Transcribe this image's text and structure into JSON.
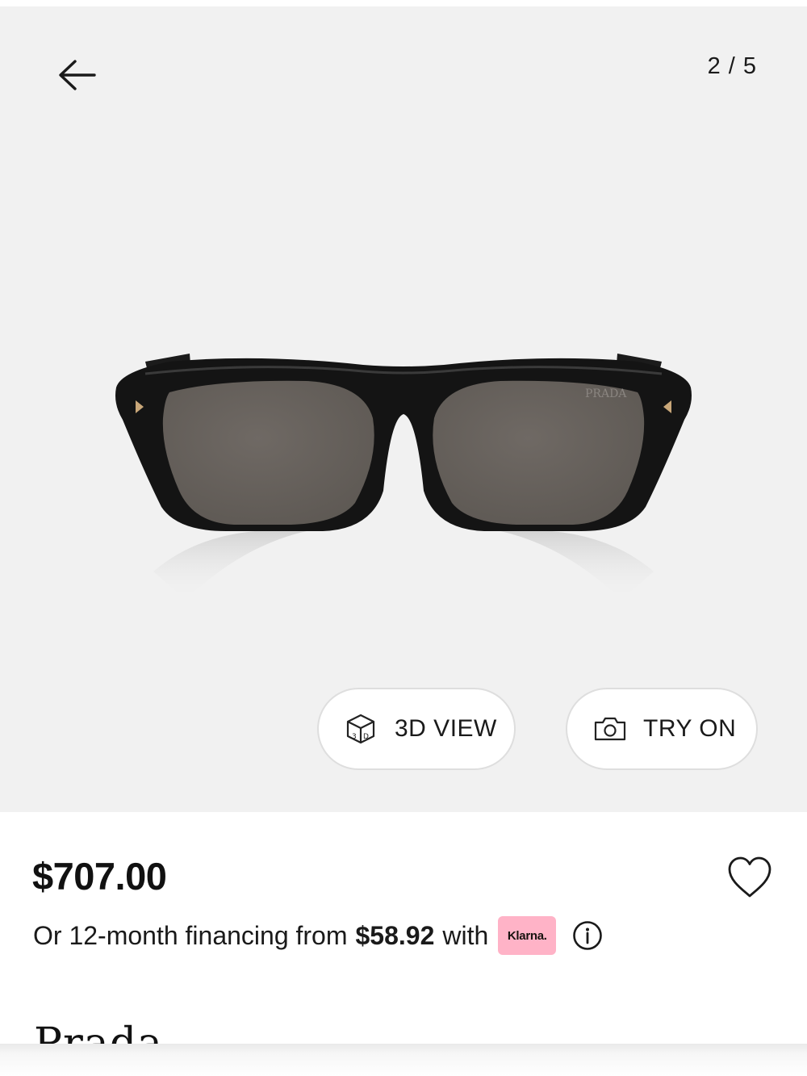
{
  "gallery": {
    "counter": "2 / 5",
    "brand_mark": "PRADA",
    "view_3d_label": "3D VIEW",
    "try_on_label": "TRY ON"
  },
  "product": {
    "price": "$707.00",
    "financing_prefix": "Or 12-month financing from",
    "financing_amount": "$58.92",
    "financing_suffix": "with",
    "klarna_label": "Klarna.",
    "brand": "Prada"
  },
  "colors": {
    "gallery_bg": "#f1f1f1",
    "klarna_pink": "#ffb3c7",
    "text": "#111111"
  },
  "icons": {
    "back": "arrow-left-icon",
    "cube": "3d-cube-icon",
    "camera": "camera-icon",
    "wishlist": "heart-icon",
    "info": "info-icon"
  }
}
